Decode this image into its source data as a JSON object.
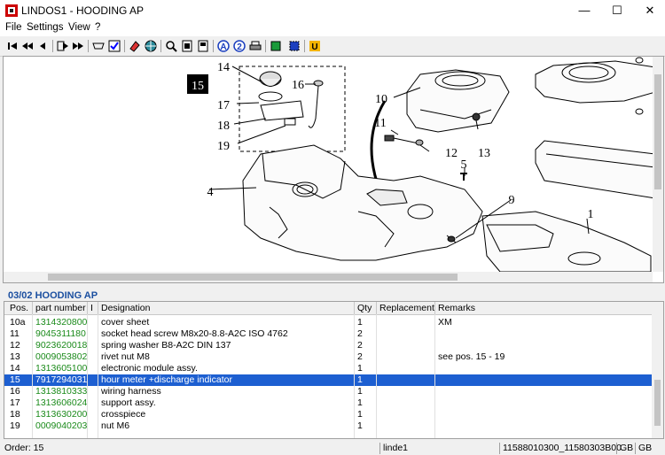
{
  "window": {
    "title": "LINDOS1 - HOODING AP",
    "minimize": "—",
    "maximize": "☐",
    "close": "✕"
  },
  "menu": {
    "items": [
      "File",
      "Settings",
      "View",
      "?"
    ]
  },
  "toolbar": {
    "buttons": [
      "first-icon",
      "prev-page-icon",
      "prev-icon",
      "next-icon",
      "forward-icon",
      "order-icon",
      "list-icon",
      "eraser-icon",
      "globe-icon",
      "zoom-icon",
      "fit-page-icon",
      "fit-width-icon",
      "info-a-icon",
      "info-2-icon",
      "print-icon",
      "book-icon",
      "select-icon",
      "u-icon"
    ]
  },
  "drawing": {
    "labels": [
      "14",
      "15",
      "16",
      "17",
      "18",
      "19",
      "10",
      "11",
      "12",
      "13",
      "4",
      "5",
      "9",
      "1"
    ]
  },
  "section": {
    "title": "03/02   HOODING AP"
  },
  "table": {
    "headers": {
      "pos": "Pos.",
      "part": "part number",
      "i": "I",
      "desig": "Designation",
      "qty": "Qty",
      "repl": "Replacement",
      "rem": "Remarks"
    },
    "rows": [
      {
        "pos": "10a",
        "part": "1314320800",
        "desig": "cover sheet",
        "qty": "1",
        "repl": "",
        "rem": "XM"
      },
      {
        "pos": "11",
        "part": "9045311180",
        "desig": "socket head screw M8x20-8.8-A2C  ISO 4762",
        "qty": "2",
        "repl": "",
        "rem": ""
      },
      {
        "pos": "12",
        "part": "9023620018",
        "desig": "spring washer B8-A2C  DIN 137",
        "qty": "2",
        "repl": "",
        "rem": ""
      },
      {
        "pos": "13",
        "part": "0009053802",
        "desig": "rivet nut M8",
        "qty": "2",
        "repl": "",
        "rem": "see pos. 15 - 19"
      },
      {
        "pos": "14",
        "part": "1313605100",
        "desig": "electronic module assy.",
        "qty": "1",
        "repl": "",
        "rem": ""
      },
      {
        "pos": "15",
        "part": "7917294031",
        "desig": "hour meter +discharge indicator",
        "qty": "1",
        "repl": "",
        "rem": ""
      },
      {
        "pos": "16",
        "part": "1313810333",
        "desig": "wiring harness",
        "qty": "1",
        "repl": "",
        "rem": ""
      },
      {
        "pos": "17",
        "part": "1313606024",
        "desig": "support assy.",
        "qty": "1",
        "repl": "",
        "rem": ""
      },
      {
        "pos": "18",
        "part": "1313630200",
        "desig": "crosspiece",
        "qty": "1",
        "repl": "",
        "rem": ""
      },
      {
        "pos": "19",
        "part": "0009040203",
        "desig": "nut M6",
        "qty": "1",
        "repl": "",
        "rem": ""
      }
    ],
    "selected_index": 5
  },
  "status": {
    "order": "Order: 15",
    "user": "linde1",
    "ids": "11588010300_11580303B00",
    "lang1": "GB",
    "lang2": "GB"
  },
  "colors": {
    "selection": "#1d5fd1",
    "part_number": "#1a8a1a",
    "section_title": "#1b4fa0"
  }
}
